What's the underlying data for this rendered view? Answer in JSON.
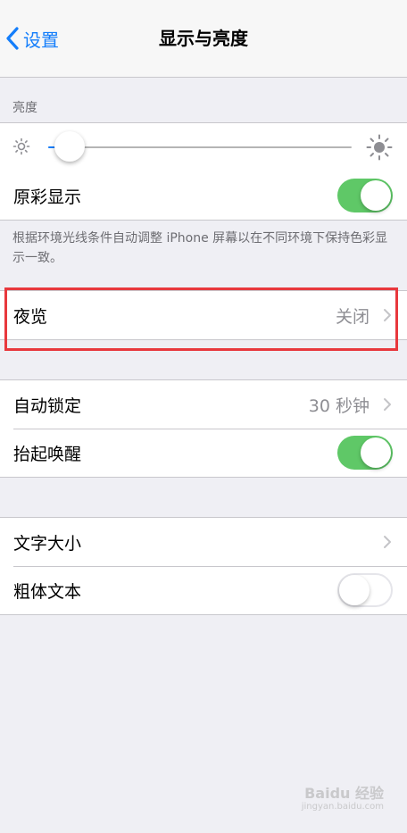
{
  "nav": {
    "back_label": "设置",
    "title": "显示与亮度"
  },
  "brightness": {
    "header": "亮度",
    "level_fraction": 0.07,
    "true_tone_label": "原彩显示",
    "true_tone_on": true,
    "footnote": "根据环境光线条件自动调整 iPhone 屏幕以在不同环境下保持色彩显示一致。"
  },
  "night_shift": {
    "label": "夜览",
    "value": "关闭"
  },
  "lock": {
    "auto_lock_label": "自动锁定",
    "auto_lock_value": "30 秒钟",
    "raise_to_wake_label": "抬起唤醒",
    "raise_to_wake_on": true
  },
  "text": {
    "text_size_label": "文字大小",
    "bold_text_label": "粗体文本",
    "bold_text_on": false
  },
  "watermark": {
    "text": "Baidu 经验",
    "sub": "jingyan.baidu.com"
  },
  "colors": {
    "accent": "#147efb",
    "toggle_on": "#5fc867",
    "background": "#efeff4",
    "highlight": "#e8383d"
  }
}
